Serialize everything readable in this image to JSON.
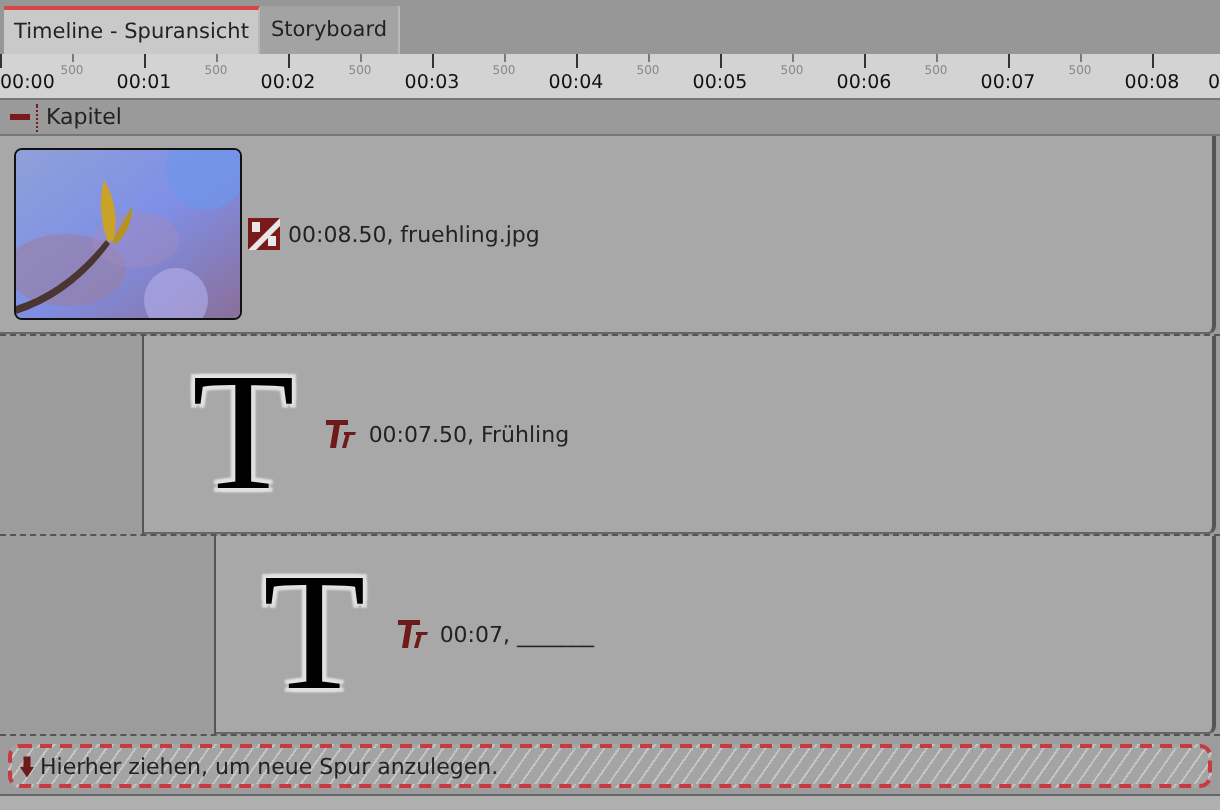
{
  "tabs": [
    {
      "label": "Timeline - Spuransicht",
      "selected": true
    },
    {
      "label": "Storyboard",
      "selected": false
    }
  ],
  "ruler": {
    "major": [
      "00:00",
      "00:01",
      "00:02",
      "00:03",
      "00:04",
      "00:05",
      "00:06",
      "00:07",
      "00:08"
    ],
    "minor": [
      "500",
      "500",
      "500",
      "500",
      "500",
      "500",
      "500",
      "500"
    ],
    "edge_label": "0"
  },
  "chapter": {
    "label": "Kapitel",
    "expanded": true
  },
  "tracks": [
    {
      "info": "00:08.50, fruehling.jpg"
    },
    {
      "kind": "text",
      "glyph": "T",
      "info": "00:07.50, Frühling"
    },
    {
      "kind": "text",
      "glyph": "T",
      "info": "00:07, _______"
    }
  ],
  "drop_zone": {
    "label": "Hierher ziehen, um neue Spur anzulegen."
  }
}
